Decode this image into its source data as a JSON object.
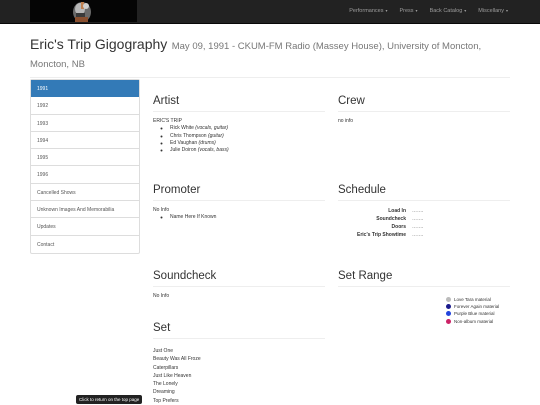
{
  "nav": {
    "items": [
      {
        "label": "Performances"
      },
      {
        "label": "Press"
      },
      {
        "label": "Back Catalog"
      },
      {
        "label": "Miscellany"
      }
    ],
    "caret": "▾"
  },
  "header": {
    "title": "Eric's Trip Gigography",
    "subtitle": "May 09, 1991 - CKUM-FM Radio (Massey House), University of Moncton, Moncton, NB"
  },
  "sidebar": {
    "items": [
      {
        "label": "1991"
      },
      {
        "label": "1992"
      },
      {
        "label": "1993"
      },
      {
        "label": "1994"
      },
      {
        "label": "1995"
      },
      {
        "label": "1996"
      },
      {
        "label": "Cancelled Shows"
      },
      {
        "label": "Unknown Images And Memorabilia"
      },
      {
        "label": "Updates"
      },
      {
        "label": "Contact"
      }
    ]
  },
  "artist": {
    "heading": "Artist",
    "band": "ERIC'S TRIP",
    "members": [
      {
        "name": "Rick White",
        "role": "(vocals, guitar)"
      },
      {
        "name": "Chris Thompson",
        "role": "(guitar)"
      },
      {
        "name": "Ed Vaughan",
        "role": "(drums)"
      },
      {
        "name": "Julie Doiron",
        "role": "(vocals, bass)"
      }
    ]
  },
  "crew": {
    "heading": "Crew",
    "text": "no info"
  },
  "promoter": {
    "heading": "Promoter",
    "text": "No Info",
    "sub": "Name Here If Known"
  },
  "schedule": {
    "heading": "Schedule",
    "rows": [
      {
        "key": "Load In",
        "value": "……."
      },
      {
        "key": "Soundcheck",
        "value": "……."
      },
      {
        "key": "Doors",
        "value": "……."
      },
      {
        "key": "Eric's Trip Showtime",
        "value": "……."
      }
    ]
  },
  "soundcheck": {
    "heading": "Soundcheck",
    "text": "No Info"
  },
  "set_range": {
    "heading": "Set Range",
    "legend": [
      {
        "label": "Love Tara material",
        "color": "#bbbbbb"
      },
      {
        "label": "Forever Again material",
        "color": "#1a1a8c"
      },
      {
        "label": "Purple Blue material",
        "color": "#2244dd"
      },
      {
        "label": "Non-album material",
        "color": "#cc2266"
      }
    ]
  },
  "set": {
    "heading": "Set",
    "songs": [
      "Just One",
      "Beauty Was All Froze",
      "Caterpillars",
      "Just Like Heaven",
      "The Lonely",
      "Dreaming",
      "Top Prefers"
    ]
  },
  "back_to_top": "Click to return on the top page"
}
